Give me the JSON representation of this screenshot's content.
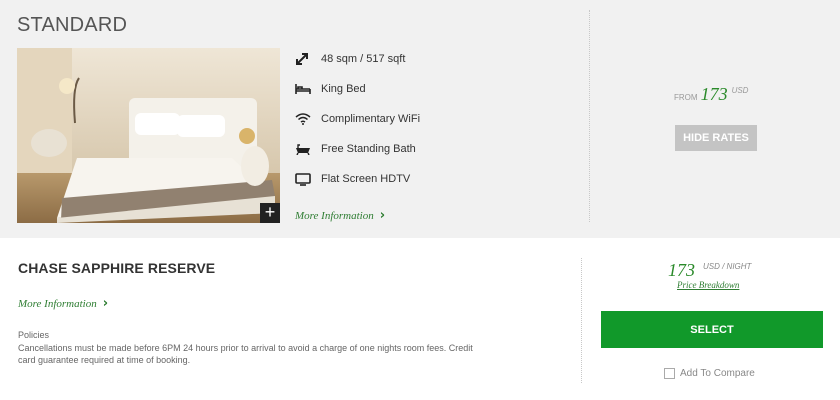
{
  "room": {
    "title": "STANDARD",
    "amenities": [
      {
        "icon": "room-size-icon",
        "label": "48 sqm / 517 sqft"
      },
      {
        "icon": "bed-icon",
        "label": "King Bed"
      },
      {
        "icon": "wifi-icon",
        "label": "Complimentary WiFi"
      },
      {
        "icon": "bathtub-icon",
        "label": "Free Standing Bath"
      },
      {
        "icon": "tv-icon",
        "label": "Flat Screen HDTV"
      }
    ],
    "more_info": "More Information",
    "expand_symbol": "+",
    "from_label": "FROM",
    "from_price": "173",
    "from_currency": "USD",
    "hide_rates_label": "HIDE RATES"
  },
  "rate": {
    "title": "CHASE SAPPHIRE RESERVE",
    "more_info": "More Information",
    "policies_label": "Policies",
    "policies_text": "Cancellations must be made before 6PM 24 hours prior to arrival to avoid a charge of one nights room fees. Credit card guarantee required at time of booking.",
    "price": "173",
    "unit": "USD / NIGHT",
    "price_breakdown": "Price Breakdown",
    "select_label": "SELECT",
    "compare_label": "Add To Compare"
  },
  "colors": {
    "accent_green": "#11992a",
    "price_green": "#2a8a2a",
    "card_bg": "#f1f1f1"
  }
}
